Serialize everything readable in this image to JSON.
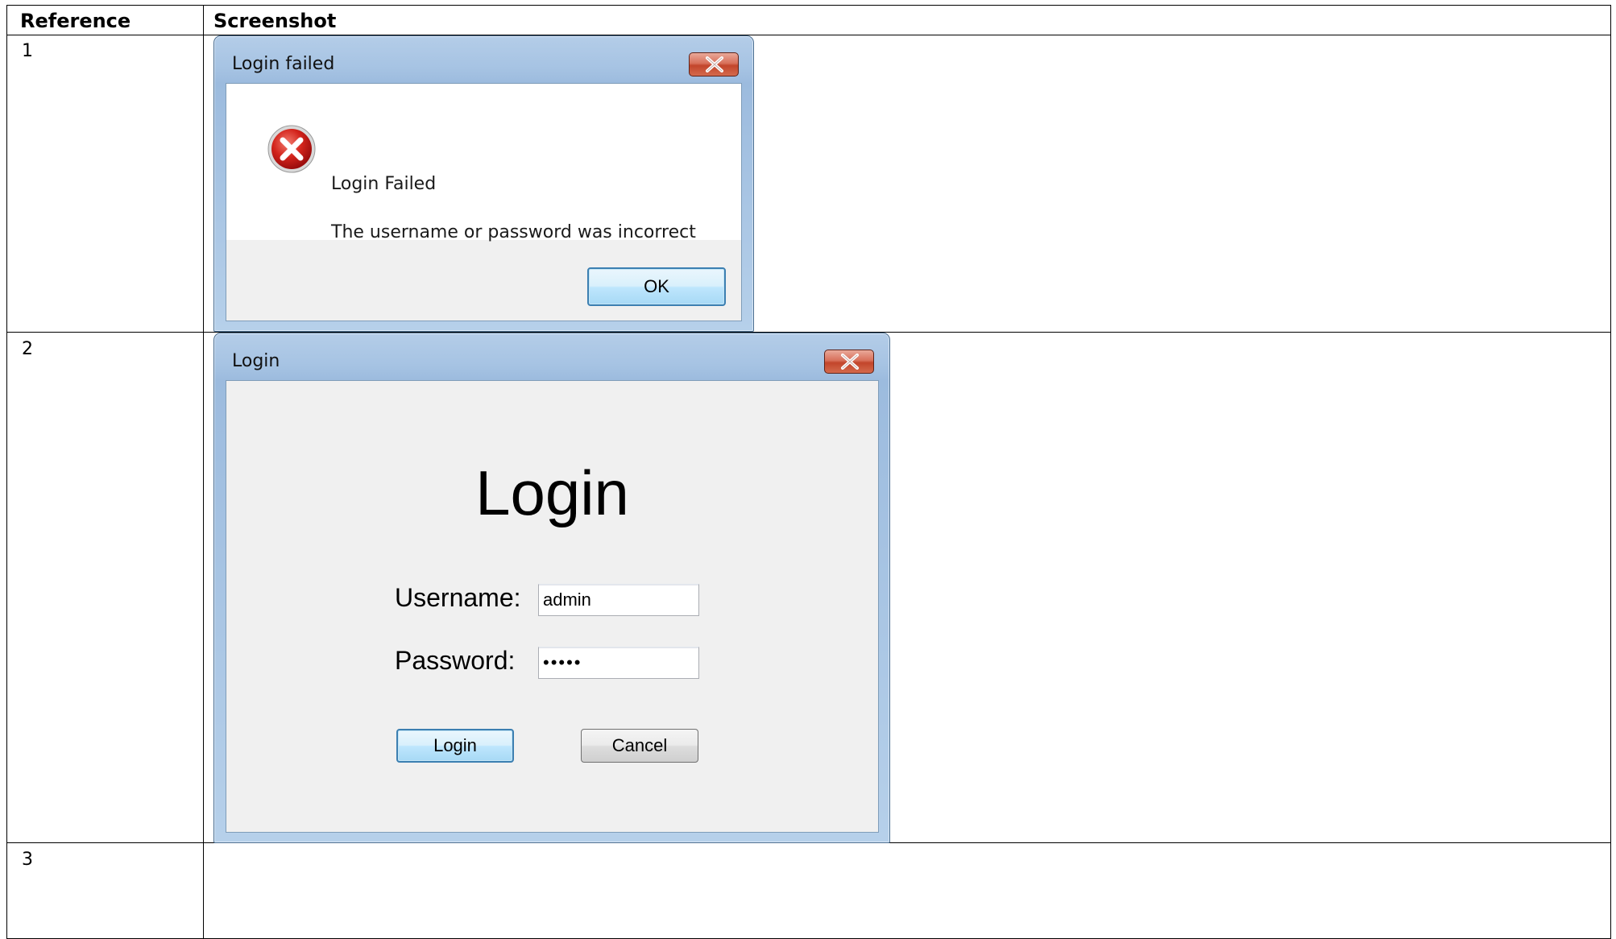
{
  "table": {
    "headers": {
      "reference": "Reference",
      "screenshot": "Screenshot"
    },
    "rows": [
      {
        "ref": "1"
      },
      {
        "ref": "2"
      },
      {
        "ref": "3"
      }
    ]
  },
  "dialog_error": {
    "title": "Login failed",
    "heading": "Login Failed",
    "message": "The username or password was incorrect",
    "ok_label": "OK",
    "icon": "error-icon"
  },
  "dialog_login": {
    "title": "Login",
    "heading": "Login",
    "username_label": "Username:",
    "username_value": "admin",
    "password_label": "Password:",
    "password_value": "•••••",
    "login_label": "Login",
    "cancel_label": "Cancel"
  },
  "colors": {
    "frame": "#a6c3e3",
    "close_button": "#c7482c",
    "default_button_border": "#3c7fb1",
    "client": "#f0f0f0"
  }
}
